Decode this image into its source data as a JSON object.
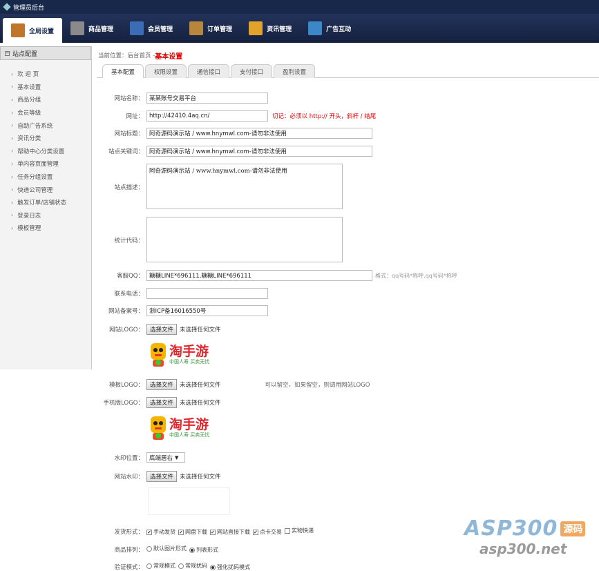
{
  "app": {
    "title": "管理员后台"
  },
  "nav": [
    {
      "label": "全局设置",
      "icon": "settings-icon",
      "color": "#c0762a",
      "active": true
    },
    {
      "label": "商品管理",
      "icon": "grid-icon",
      "color": "#8a8a8a"
    },
    {
      "label": "会员管理",
      "icon": "members-icon",
      "color": "#3a6db5"
    },
    {
      "label": "订单管理",
      "icon": "order-icon",
      "color": "#b8863b"
    },
    {
      "label": "资讯管理",
      "icon": "news-icon",
      "color": "#e2a32c"
    },
    {
      "label": "广告互动",
      "icon": "ad-icon",
      "color": "#3b87c8"
    }
  ],
  "sidebar": {
    "header": "站点配置",
    "items": [
      "欢 迎 页",
      "基本设置",
      "商品分组",
      "会员等级",
      "自助广告系统",
      "资讯分类",
      "帮助中心分类设置",
      "单内容页面管理",
      "任务分组设置",
      "快递公司管理",
      "触发订单/店铺状态",
      "登录日志",
      "模板管理"
    ]
  },
  "breadcrumb": {
    "prefix": "当前位置：后台首页 - ",
    "current": "基本设置"
  },
  "tabs": [
    "基本配置",
    "权限设置",
    "通信接口",
    "支付接口",
    "盈利设置"
  ],
  "form": {
    "site_name": {
      "label": "网站名称：",
      "value": "某某账号交易平台"
    },
    "url": {
      "label": "网址：",
      "value": "http://42410.4aq.cn/",
      "note": "切记：必须以 http:// 开头，斜杆 / 结尾"
    },
    "site_title": {
      "label": "网站标题：",
      "value": "阿奇源码演示站 / www.hnymwl.com-请勿非法使用"
    },
    "keywords": {
      "label": "站点关键词：",
      "value": "阿奇源码演示站 / www.hnymwl.com-请勿非法使用"
    },
    "description": {
      "label": "站点描述：",
      "value": "阿奇源码演示站 / www.hnymwl.com-请勿非法使用"
    },
    "stats": {
      "label": "统计代码：",
      "value": ""
    },
    "qq": {
      "label": "客服QQ：",
      "value": "糖糖LINE*696111,糖糖LINE*696111",
      "note": "格式：qq号码*称呼,qq号码*称呼"
    },
    "phone": {
      "label": "联系电话：",
      "value": ""
    },
    "icp": {
      "label": "网站备案号：",
      "value": "浙ICP备16016550号"
    },
    "logo": {
      "label": "网站LOGO：",
      "btn": "选择文件",
      "status": "未选择任何文件"
    },
    "tpl_logo": {
      "label": "模板LOGO：",
      "btn": "选择文件",
      "status": "未选择任何文件",
      "note": "可以留空，如果留空，则调用网站LOGO"
    },
    "mobile_logo": {
      "label": "手机版LOGO：",
      "btn": "选择文件",
      "status": "未选择任何文件"
    },
    "watermark_pos": {
      "label": "水印位置：",
      "value": "底端居右"
    },
    "watermark": {
      "label": "网站水印：",
      "btn": "选择文件",
      "status": "未选择任何文件"
    },
    "delivery": {
      "label": "发货形式：",
      "options": [
        {
          "text": "手动发货",
          "checked": true
        },
        {
          "text": "网盘下载",
          "checked": true
        },
        {
          "text": "网站直接下载",
          "checked": true
        },
        {
          "text": "点卡交易",
          "checked": true
        },
        {
          "text": "实物快递",
          "checked": false
        }
      ]
    },
    "sort": {
      "label": "商品排列：",
      "options": [
        {
          "text": "默认图片形式",
          "checked": false
        },
        {
          "text": "列表形式",
          "checked": true
        }
      ]
    },
    "verify": {
      "label": "验证模式：",
      "options": [
        {
          "text": "常规模式",
          "checked": false
        },
        {
          "text": "常规扰码",
          "checked": false
        },
        {
          "text": "强化扰码模式",
          "checked": true
        }
      ]
    }
  },
  "logo_image": {
    "main": "淘手游",
    "sub": "中国人寿 买卖无忧"
  },
  "watermark_brand": {
    "big": "ASP300",
    "tag": "源码",
    "url": "asp300.net"
  }
}
